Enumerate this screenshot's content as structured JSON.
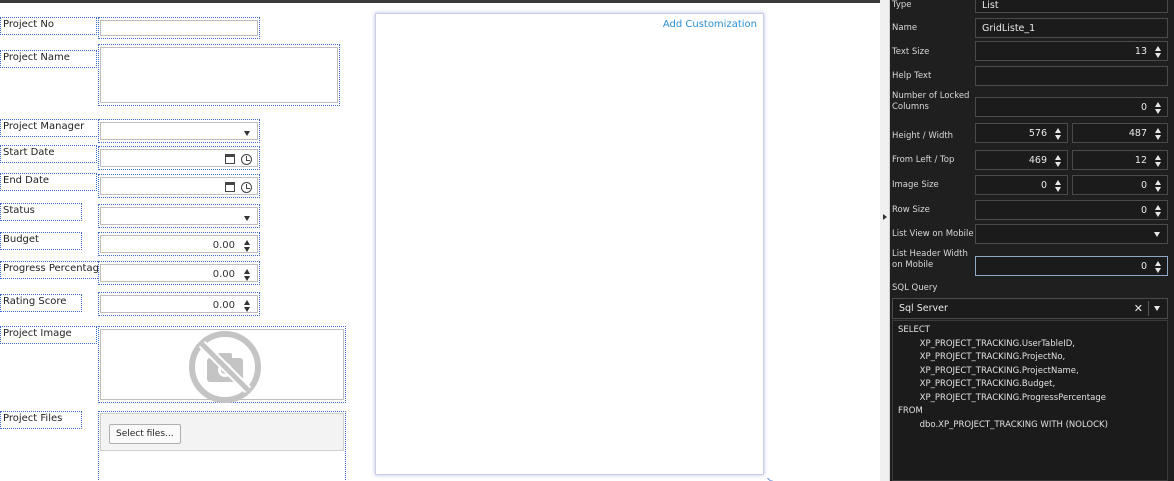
{
  "designer": {
    "fields": [
      {
        "label": "Project No"
      },
      {
        "label": "Project Name"
      },
      {
        "label": "Project Manager"
      },
      {
        "label": "Start Date"
      },
      {
        "label": "End Date"
      },
      {
        "label": "Status"
      },
      {
        "label": "Budget",
        "value": "0.00"
      },
      {
        "label": "Progress Percentage",
        "value": "0.00"
      },
      {
        "label": "Rating Score",
        "value": "0.00"
      },
      {
        "label": "Project Image"
      },
      {
        "label": "Project Files"
      }
    ],
    "select_files_label": "Select files...",
    "grid": {
      "add_customization_label": "Add Customization"
    }
  },
  "properties": {
    "type": {
      "label": "Type",
      "value": "List"
    },
    "name": {
      "label": "Name",
      "value": "GridListe_1"
    },
    "text_size": {
      "label": "Text Size",
      "value": "13"
    },
    "help_text": {
      "label": "Help Text",
      "value": ""
    },
    "locked_columns": {
      "label_line1": "Number of Locked",
      "label_line2": "Columns",
      "value": "0"
    },
    "height_width": {
      "label": "Height / Width",
      "height": "576",
      "width": "487"
    },
    "from_left_top": {
      "label": "From Left / Top",
      "left": "469",
      "top": "12"
    },
    "image_size": {
      "label": "Image Size",
      "a": "0",
      "b": "0"
    },
    "row_size": {
      "label": "Row Size",
      "value": "0"
    },
    "list_view_mobile": {
      "label": "List View on Mobile",
      "value": ""
    },
    "list_header_width": {
      "label_line1": "List Header Width",
      "label_line2": "on Mobile",
      "value": "0"
    },
    "sql_query": {
      "label": "SQL Query",
      "provider": "Sql Server",
      "lines": [
        "SELECT",
        "        XP_PROJECT_TRACKING.UserTableID,",
        "        XP_PROJECT_TRACKING.ProjectNo,",
        "        XP_PROJECT_TRACKING.ProjectName,",
        "        XP_PROJECT_TRACKING.Budget,",
        "        XP_PROJECT_TRACKING.ProgressPercentage",
        "FROM",
        "        dbo.XP_PROJECT_TRACKING WITH (NOLOCK)"
      ]
    }
  },
  "colors": {
    "accent": "#2d8fd5",
    "selection_border": "#3d6bc7",
    "panel_bg": "#1f1f1f"
  },
  "icons": [
    "calendar-icon",
    "clock-icon",
    "no-camera-icon",
    "spinner-icon",
    "chevron-down-icon",
    "close-icon"
  ]
}
